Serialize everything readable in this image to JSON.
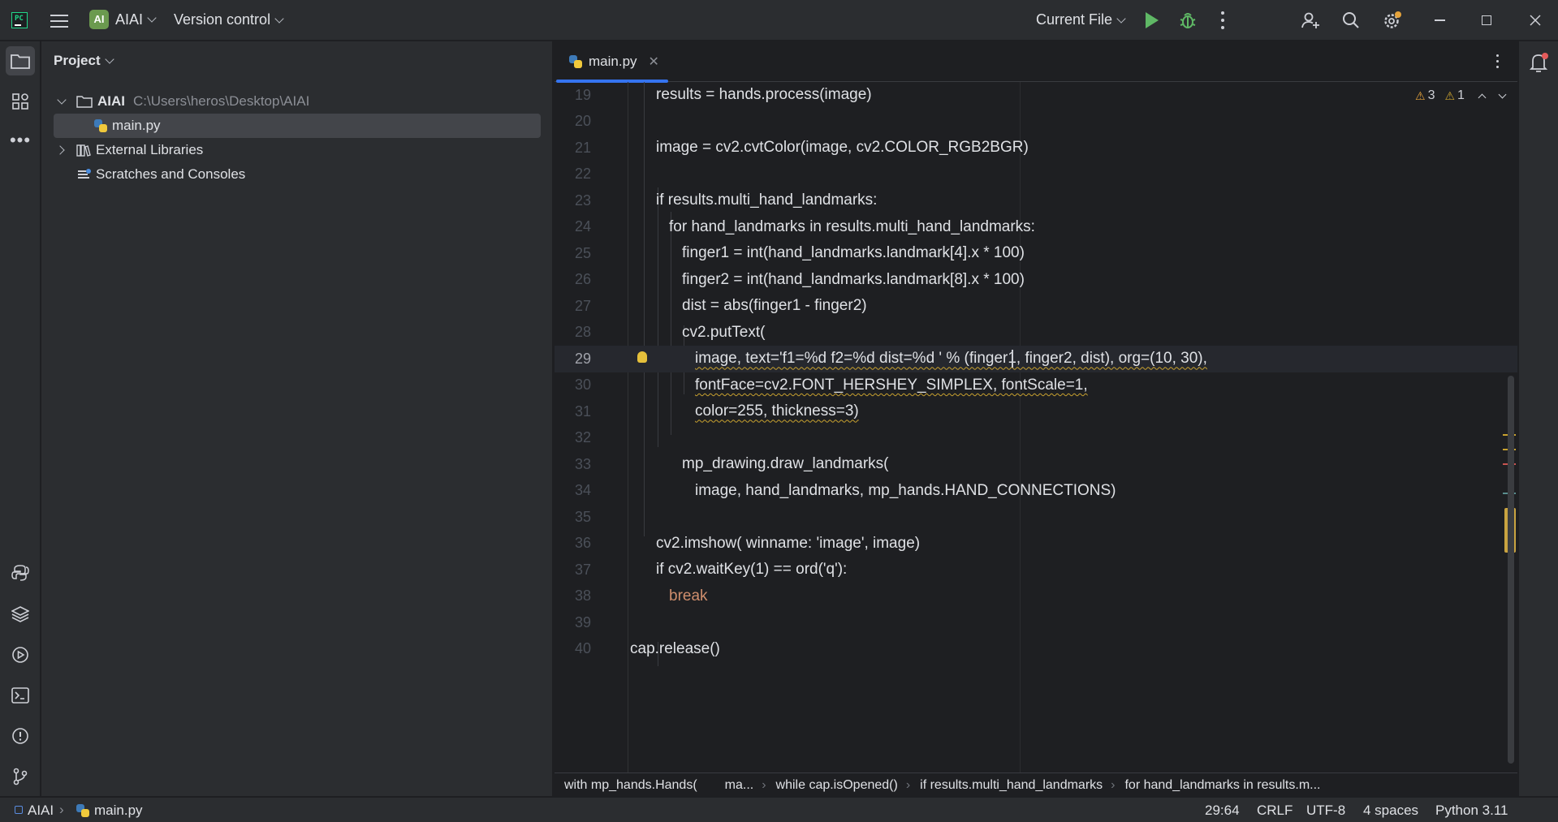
{
  "titlebar": {
    "project_badge": "AI",
    "project_name": "AIAI",
    "vcs": "Version control",
    "run_config": "Current File"
  },
  "project_panel": {
    "title": "Project",
    "root_name": "AIAI",
    "root_path": "C:\\Users\\heros\\Desktop\\AIAI",
    "file": "main.py",
    "external_libraries": "External Libraries",
    "scratches": "Scratches and Consoles"
  },
  "editor": {
    "tab_label": "main.py",
    "inspections": {
      "warnings": "3",
      "weak_warnings": "1"
    },
    "inlay_hint": "winname:"
  },
  "code_lines": [
    {
      "n": "19",
      "text": "results = hands.process(image)"
    },
    {
      "n": "20",
      "text": ""
    },
    {
      "n": "21",
      "text": "image = cv2.cvtColor(image, cv2.COLOR_RGB2BGR)"
    },
    {
      "n": "22",
      "text": ""
    },
    {
      "n": "23",
      "text": "if results.multi_hand_landmarks:"
    },
    {
      "n": "24",
      "text": "for hand_landmarks in results.multi_hand_landmarks:"
    },
    {
      "n": "25",
      "text": "finger1 = int(hand_landmarks.landmark[4].x * 100)"
    },
    {
      "n": "26",
      "text": "finger2 = int(hand_landmarks.landmark[8].x * 100)"
    },
    {
      "n": "27",
      "text": "dist = abs(finger1 - finger2)"
    },
    {
      "n": "28",
      "text": "cv2.putText("
    },
    {
      "n": "29",
      "text": "image, text='f1=%d f2=%d dist=%d ' % (finger1, finger2, dist), org=(10, 30),"
    },
    {
      "n": "30",
      "text": "fontFace=cv2.FONT_HERSHEY_SIMPLEX, fontScale=1,"
    },
    {
      "n": "31",
      "text": "color=255, thickness=3)"
    },
    {
      "n": "32",
      "text": ""
    },
    {
      "n": "33",
      "text": "mp_drawing.draw_landmarks("
    },
    {
      "n": "34",
      "text": "image, hand_landmarks, mp_hands.HAND_CONNECTIONS)"
    },
    {
      "n": "35",
      "text": ""
    },
    {
      "n": "36",
      "text": "cv2.imshow( winname: 'image', image)"
    },
    {
      "n": "37",
      "text": "if cv2.waitKey(1) == ord('q'):"
    },
    {
      "n": "38",
      "text": "break"
    },
    {
      "n": "39",
      "text": ""
    },
    {
      "n": "40",
      "text": "cap.release()"
    }
  ],
  "breadcrumbs": [
    "with mp_hands.Hands(",
    "ma...",
    "while cap.isOpened()",
    "if results.multi_hand_landmarks",
    "for hand_landmarks in results.m..."
  ],
  "statusbar": {
    "project": "AIAI",
    "file": "main.py",
    "position": "29:64",
    "line_sep": "CRLF",
    "encoding": "UTF-8",
    "indent": "4 spaces",
    "interpreter": "Python 3.11"
  },
  "colors": {
    "keyword": "#cf8e6d",
    "number": "#2aacb8",
    "string": "#6aab73",
    "param": "#aa4926",
    "builtin": "#8888c6",
    "accent": "#3574f0"
  }
}
